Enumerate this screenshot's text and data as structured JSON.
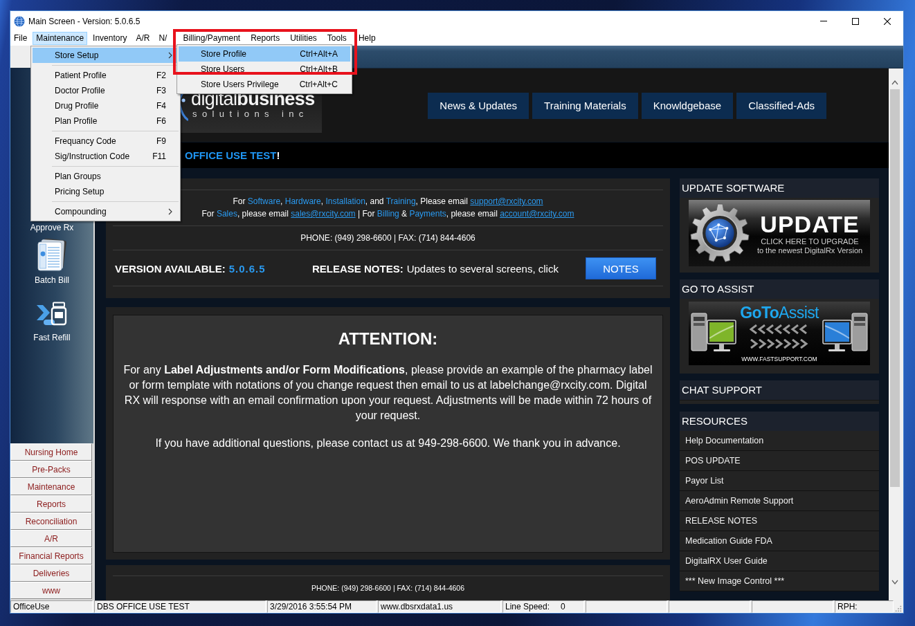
{
  "window": {
    "title": "Main Screen - Version: 5.0.6.5"
  },
  "menu_bar": [
    {
      "label": "File",
      "selected": false
    },
    {
      "label": "Maintenance",
      "selected": true
    },
    {
      "label": "Inventory",
      "selected": false
    },
    {
      "label": "A/R",
      "selected": false
    },
    {
      "label": "N/",
      "selected": false
    },
    {
      "label": "Billing/Payment",
      "selected": false
    },
    {
      "label": "Reports",
      "selected": false
    },
    {
      "label": "Utilities",
      "selected": false
    },
    {
      "label": "Tools",
      "selected": false
    },
    {
      "label": "Help",
      "selected": false
    }
  ],
  "maintenance_menu": {
    "items": [
      {
        "kind": "submenu",
        "label": "Store Setup",
        "selected": true
      },
      {
        "kind": "separator"
      },
      {
        "kind": "item",
        "label": "Patient Profile",
        "shortcut": "F2",
        "selected": false
      },
      {
        "kind": "item",
        "label": "Doctor Profile",
        "shortcut": "F3",
        "selected": false
      },
      {
        "kind": "item",
        "label": "Drug Profile",
        "shortcut": "F4",
        "selected": false
      },
      {
        "kind": "item",
        "label": "Plan Profile",
        "shortcut": "F6",
        "selected": false
      },
      {
        "kind": "separator"
      },
      {
        "kind": "item",
        "label": "Frequancy Code",
        "shortcut": "F9",
        "selected": false
      },
      {
        "kind": "item",
        "label": "Sig/Instruction Code",
        "shortcut": "F11",
        "selected": false
      },
      {
        "kind": "separator"
      },
      {
        "kind": "item",
        "label": "Plan Groups",
        "selected": false
      },
      {
        "kind": "item",
        "label": "Pricing Setup",
        "selected": false
      },
      {
        "kind": "separator"
      },
      {
        "kind": "submenu",
        "label": "Compounding",
        "selected": false
      }
    ]
  },
  "store_setup_menu": {
    "items": [
      {
        "label": "Store Profile",
        "shortcut": "Ctrl+Alt+A",
        "selected": true
      },
      {
        "label": "Store Users",
        "shortcut": "Ctrl+Alt+B",
        "selected": false
      },
      {
        "label": "Store Users Privilege",
        "shortcut": "Ctrl+Alt+C",
        "selected": false
      }
    ]
  },
  "sidebar": {
    "shortcuts": [
      {
        "kind": "label",
        "label": "Approve Rx"
      },
      {
        "kind": "bill",
        "label": "Batch Bill"
      },
      {
        "kind": "refill",
        "label": "Fast Refill"
      }
    ],
    "buttons": [
      "Nursing Home",
      "Pre-Packs",
      "Maintenance",
      "Reports",
      "Reconciliation",
      "A/R",
      "Financial Reports",
      "Deliveries",
      "www"
    ]
  },
  "header": {
    "logo": {
      "wordmark": "digital**business**",
      "tagline": "solutions inc"
    },
    "nav": [
      "News & Updates",
      "Training Materials",
      "Knowldgebase",
      "Classified-Ads"
    ]
  },
  "welcome": {
    "name": "OFFICE USE TEST",
    "suffix": "!"
  },
  "info": {
    "contact_lines": [
      [
        {
          "kind": "text",
          "text": "For "
        },
        {
          "kind": "accent",
          "text": "Software"
        },
        {
          "kind": "text",
          "text": ", "
        },
        {
          "kind": "accent",
          "text": "Hardware"
        },
        {
          "kind": "text",
          "text": ", "
        },
        {
          "kind": "accent",
          "text": "Installation"
        },
        {
          "kind": "text",
          "text": ", and "
        },
        {
          "kind": "accent",
          "text": "Training"
        },
        {
          "kind": "text",
          "text": ", Please email "
        },
        {
          "kind": "link",
          "text": "support@rxcity.com"
        }
      ],
      [
        {
          "kind": "text",
          "text": "For "
        },
        {
          "kind": "accent",
          "text": "Sales"
        },
        {
          "kind": "text",
          "text": ", please email "
        },
        {
          "kind": "link",
          "text": "sales@rxcity.com"
        },
        {
          "kind": "text",
          "text": " | For "
        },
        {
          "kind": "accent",
          "text": "Billing"
        },
        {
          "kind": "text",
          "text": " & "
        },
        {
          "kind": "accent",
          "text": "Payments"
        },
        {
          "kind": "text",
          "text": ", please email "
        },
        {
          "kind": "link",
          "text": "account@rxcity.com"
        }
      ]
    ],
    "phone": "PHONE: (949) 298-6600 | FAX: (714) 844-4606",
    "version_label": "VERSION AVAILABLE:",
    "version": "5.0.6.5",
    "release_label": "RELEASE NOTES:",
    "release_text": "Updates to several screens, click",
    "notes_button": "NOTES"
  },
  "attention": {
    "title": "ATTENTION:",
    "paragraphs": [
      "For any **Label Adjustments and/or Form Modifications**, please provide an example of the pharmacy label or form template with notations of you change request then email to us at labelchange@rxcity.com. Digital RX will response with an email confirmation upon your request. Adjustments will be made within 72 hours of your request.",
      "If you have additional questions, please contact us at 949-298-6600. We thank you in advance."
    ]
  },
  "footer": {
    "phone": "PHONE: (949) 298-6600 | FAX: (714) 844-4606"
  },
  "right_panel": [
    {
      "kind": "update",
      "title": "UPDATE SOFTWARE",
      "heading": "UPDATE",
      "lines": [
        "CLICK HERE TO UPGRADE",
        "to the newest DigitalRx Version"
      ]
    },
    {
      "kind": "assist",
      "title": "GO TO ASSIST",
      "heading": "**GoTo**Assist",
      "caption": "WWW.FASTSUPPORT.COM"
    },
    {
      "kind": "empty",
      "title": "CHAT SUPPORT"
    },
    {
      "kind": "links",
      "title": "RESOURCES",
      "items": [
        "Help Documentation",
        "POS UPDATE",
        "Payor List",
        "AeroAdmin Remote Support",
        "RELEASE NOTES",
        "Medication Guide FDA",
        "DigitalRX User Guide",
        "*** New Image Control ***"
      ]
    }
  ],
  "status_bar": [
    {
      "kind": "text",
      "text": "OfficeUse"
    },
    {
      "kind": "text",
      "text": "DBS OFFICE USE TEST"
    },
    {
      "kind": "text",
      "text": "3/29/2016 3:55:54 PM"
    },
    {
      "kind": "text",
      "text": "www.dbsrxdata1.us"
    },
    {
      "kind": "field",
      "label": "Line Speed:",
      "value": "0"
    },
    {
      "kind": "empty"
    },
    {
      "kind": "empty"
    },
    {
      "kind": "empty"
    },
    {
      "kind": "field",
      "label": "RPH:"
    }
  ]
}
